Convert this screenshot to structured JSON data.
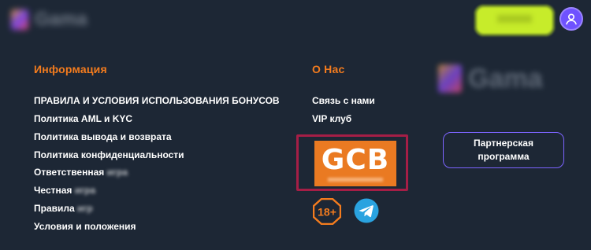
{
  "header": {
    "logo_text": "Gama",
    "login_label": "Войти",
    "avatar_icon": "user-icon"
  },
  "info": {
    "heading": "Информация",
    "links": [
      "ПРАВИЛА И УСЛОВИЯ ИСПОЛЬЗОВАНИЯ БОНУСОВ",
      "Политика AML и KYC",
      "Политика вывода и возврата",
      "Политика конфиденциальности",
      "Ответственная",
      "Честная",
      "Правила",
      "Условия и положения"
    ],
    "blurred_suffixes": [
      "игра",
      "игра",
      "игр"
    ]
  },
  "about": {
    "heading": "О Нас",
    "links": [
      "Связь с нами",
      "VIP клуб"
    ]
  },
  "badges": {
    "gcb_text": "GCB",
    "age_text": "18+",
    "telegram_icon": "telegram-icon"
  },
  "partner": {
    "logo_text": "Gama",
    "button_line1": "Партнерская",
    "button_line2": "программа"
  },
  "colors": {
    "background": "#1d2735",
    "accent_orange": "#f47c1e",
    "accent_purple": "#6f52ff",
    "login_green": "#c7ec2a",
    "frame_red": "#a51e46"
  }
}
